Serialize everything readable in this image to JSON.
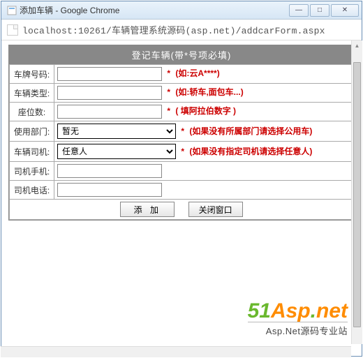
{
  "window": {
    "title": "添加车辆 - Google Chrome",
    "min": "—",
    "max": "□",
    "close": "✕"
  },
  "address": "localhost:10261/车辆管理系统源码(asp.net)/addcarForm.aspx",
  "form": {
    "header": "登记车辆(带*号项必填)",
    "rows": {
      "plate": {
        "label": "车牌号码:",
        "req": "*",
        "hint": "(如:云A****)"
      },
      "type": {
        "label": "车辆类型:",
        "req": "*",
        "hint": "(如:轿车,面包车...)"
      },
      "seats": {
        "label": "座位数:",
        "req": "*",
        "hint": "( 填阿拉伯数字 )"
      },
      "dept": {
        "label": "使用部门:",
        "value": "暂无",
        "req": "*",
        "hint": "(如果没有所属部门请选择公用车)"
      },
      "driver": {
        "label": "车辆司机:",
        "value": "任意人",
        "req": "*",
        "hint": "(如果没有指定司机请选择任意人)"
      },
      "mobile": {
        "label": "司机手机:"
      },
      "phone": {
        "label": "司机电话:"
      }
    },
    "buttons": {
      "add": "添  加",
      "close": "关闭窗口"
    }
  },
  "logo": {
    "brand_num": "51",
    "brand_a": "Asp",
    "brand_dot": ".",
    "brand_net": "net",
    "sub": "Asp.Net源码专业站"
  }
}
